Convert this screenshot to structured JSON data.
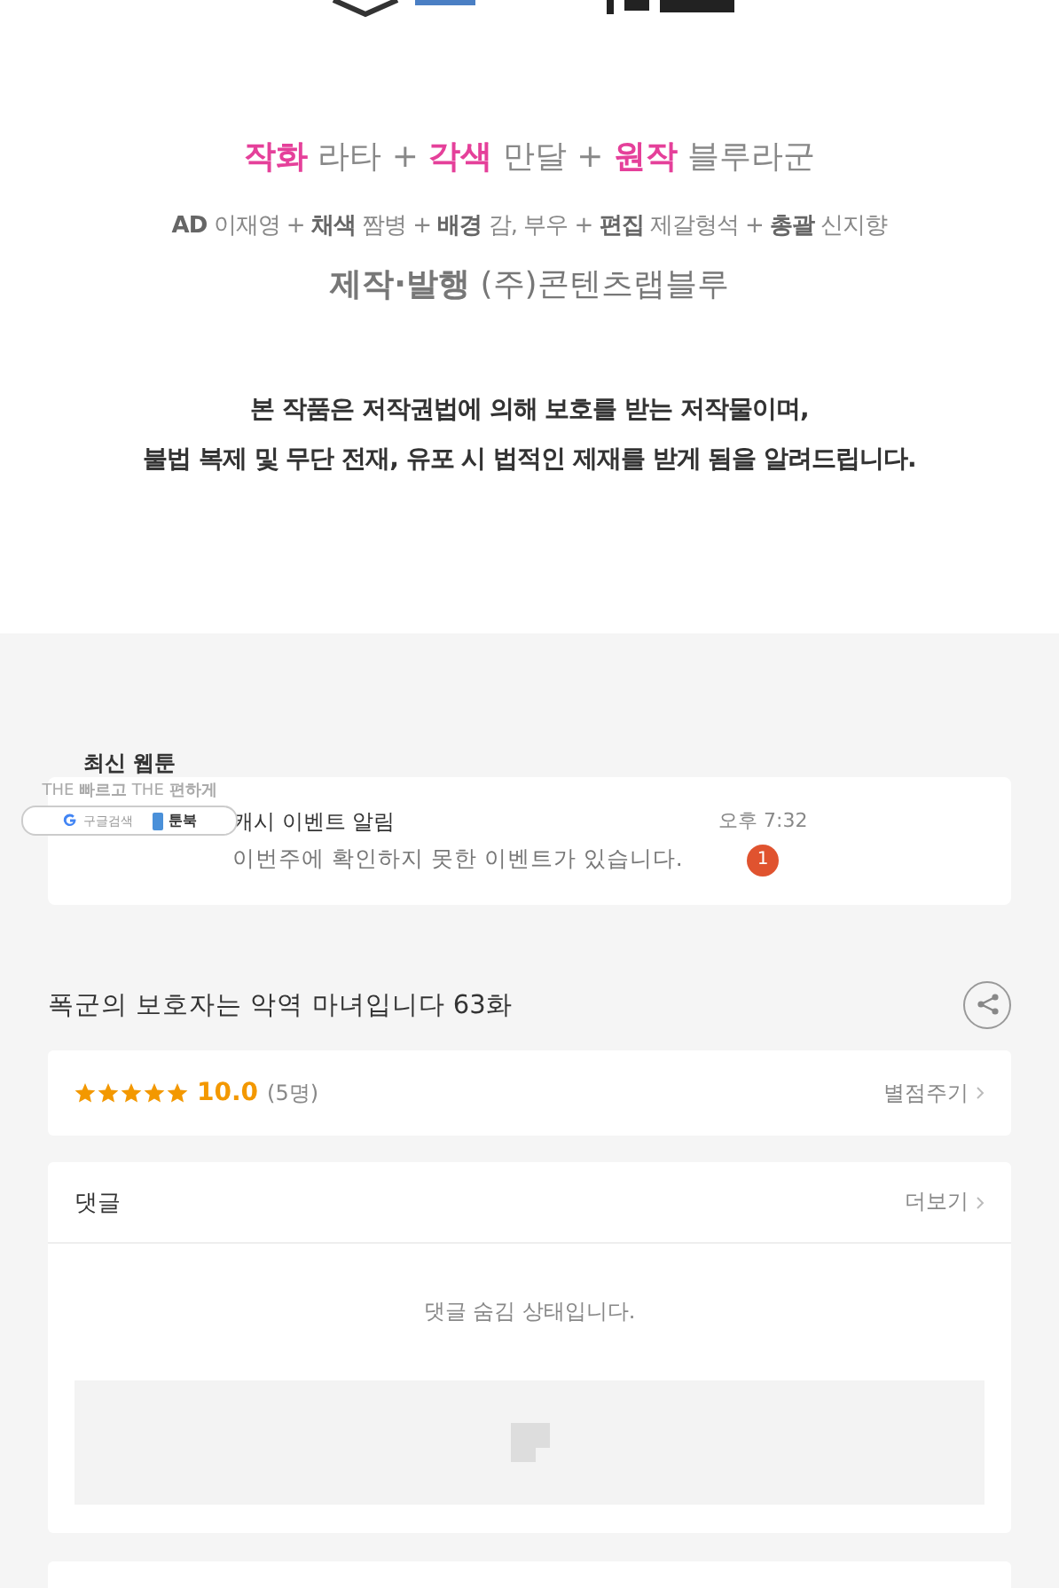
{
  "credits": [
    {
      "kind": "main",
      "text": "**작화** 라타 +  **각색** 만달  +  **원작** 블루라군"
    },
    {
      "kind": "staff",
      "text": "**AD** 이재영  +  **채색** 짬병  +  **배경** 감, 부우  +  **편집** 제갈형석  +  **총괄** 신지향"
    },
    {
      "kind": "publisher",
      "text": "**제작·발행** (주)콘텐츠랩블루"
    }
  ],
  "notice": [
    "본 작품은 저작권법에 의해 보호를 받는 저작물이며,",
    "불법 복제 및 무단 전재, 유포 시 법적인 제재를 받게 됨을 알려드립니다."
  ],
  "widget": {
    "title": "최신 웹툰",
    "slogan": "THE **빠르고** THE **편하게**",
    "search": "구글검색",
    "app": "툰북"
  },
  "notification": {
    "title": "캐시 이벤트 알림",
    "message": "이번주에 확인하지 못한 이벤트가 있습니다.",
    "time": "오후 7:32",
    "badge": "1"
  },
  "episode_title": "폭군의 보호자는 악역 마녀입니다 63화",
  "rating": {
    "stars": 5,
    "score": "10.0",
    "count": "(5명)",
    "action": "별점주기"
  },
  "comments": {
    "title": "댓글",
    "more": "더보기",
    "empty": "댓글 숨김 상태입니다."
  }
}
